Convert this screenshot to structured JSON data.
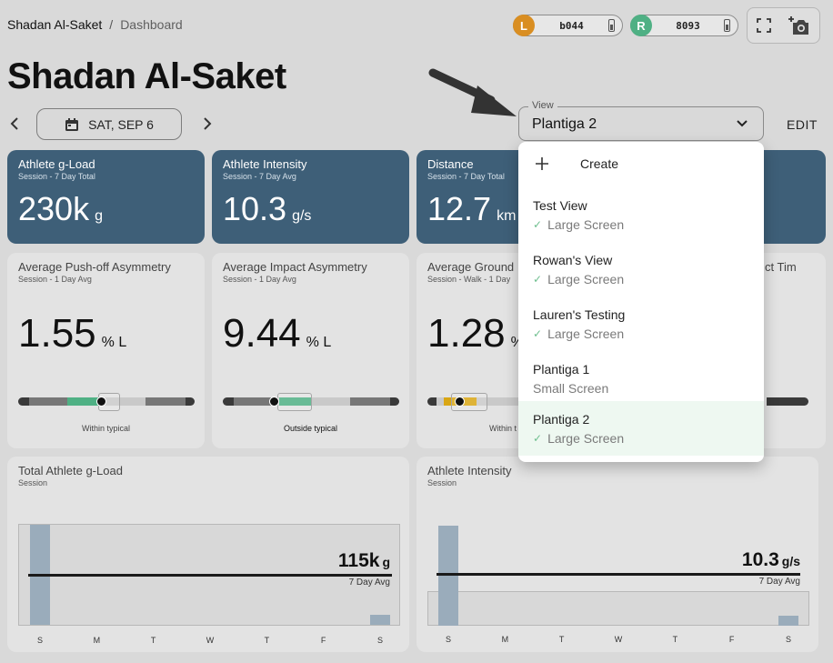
{
  "breadcrumb": {
    "home": "Shadan Al-Saket",
    "separator": "/",
    "current": "Dashboard"
  },
  "devices": [
    {
      "badge": "L",
      "value": "b044",
      "color": "#d98e22"
    },
    {
      "badge": "R",
      "value": "8093",
      "color": "#4fb084"
    }
  ],
  "page_title": "Shadan Al-Saket",
  "date_label": "SAT, SEP 6",
  "view": {
    "label": "View",
    "value": "Plantiga 2",
    "edit": "EDIT"
  },
  "cards": [
    {
      "title": "Athlete g-Load",
      "subtitle": "Session - 7 Day Total",
      "value": "230k",
      "unit": "g"
    },
    {
      "title": "Athlete Intensity",
      "subtitle": "Session - 7 Day Avg",
      "value": "10.3",
      "unit": "g/s"
    },
    {
      "title": "Distance",
      "subtitle": "Session - 7 Day Total",
      "value": "12.7",
      "unit": "km"
    }
  ],
  "asymmetry": [
    {
      "title": "Average Push-off Asymmetry",
      "subtitle": "Session - 1 Day Avg",
      "value": "1.55",
      "unit": "% L",
      "status": "Within typical",
      "marker": 0.47
    },
    {
      "title": "Average Impact Asymmetry",
      "subtitle": "Session - 1 Day Avg",
      "value": "9.44",
      "unit": "% L",
      "status": "Outside typical",
      "marker": 0.29
    },
    {
      "title": "Average Ground",
      "subtitle": "Session - Walk - 1 Day",
      "value": "1.28",
      "unit": "%",
      "status": "Within t",
      "marker": 0.18
    }
  ],
  "fourth_card_fragment": "ct Tim",
  "charts": [
    {
      "title": "Total Athlete g-Load",
      "subtitle": "Session",
      "avg_value": "115k",
      "avg_unit": "g",
      "avg_label": "7 Day Avg",
      "days": [
        "S",
        "M",
        "T",
        "W",
        "T",
        "F",
        "S"
      ],
      "bars": [
        1.0,
        0,
        0,
        0,
        0,
        0,
        0.1
      ],
      "avg_level": 0.52
    },
    {
      "title": "Athlete Intensity",
      "subtitle": "Session",
      "avg_value": "10.3",
      "avg_unit": "g/s",
      "avg_label": "7 Day Avg",
      "days": [
        "S",
        "M",
        "T",
        "W",
        "T",
        "F",
        "S"
      ],
      "bars": [
        1.0,
        0,
        0,
        0,
        0,
        0,
        0.1
      ],
      "avg_level": 0.52
    }
  ],
  "dropdown": {
    "create_label": "Create",
    "items": [
      {
        "name": "Test View",
        "sub": "Large Screen",
        "checked": true
      },
      {
        "name": "Rowan's View",
        "sub": "Large Screen",
        "checked": true
      },
      {
        "name": "Lauren's Testing",
        "sub": "Large Screen",
        "checked": true
      },
      {
        "name": "Plantiga 1",
        "sub": "Small Screen",
        "checked": false
      },
      {
        "name": "Plantiga 2",
        "sub": "Large Screen",
        "checked": true,
        "selected": true
      }
    ]
  },
  "colors": {
    "card_blue": "#3e5f78",
    "green": "#4fb084",
    "amber": "#d9a614",
    "bar": "#9aacbb"
  }
}
